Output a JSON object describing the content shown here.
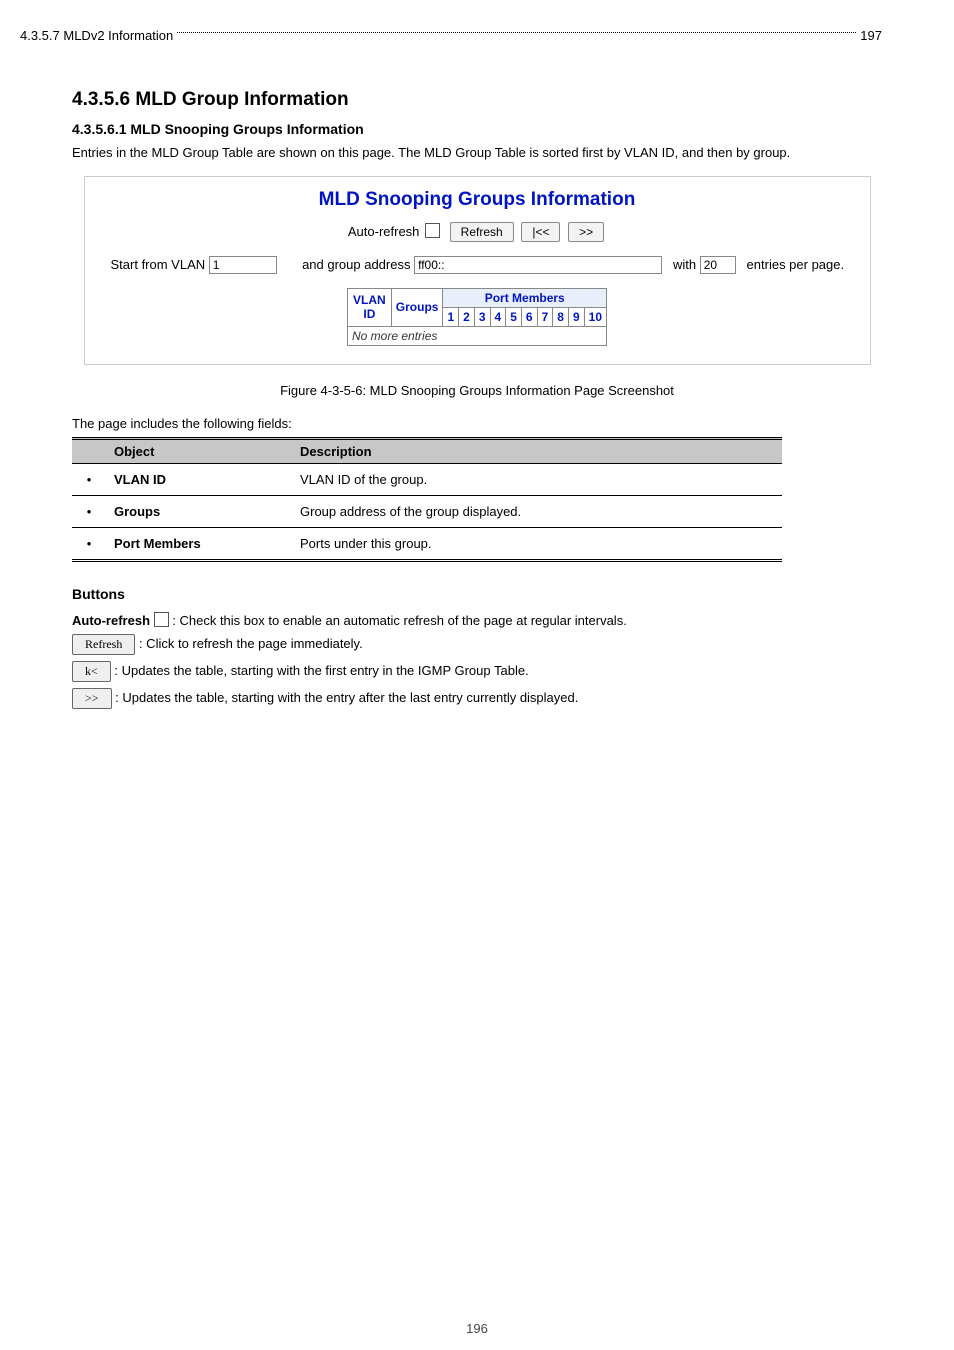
{
  "toc": [
    {
      "title": "4.3.5.7 MLDv2 Information",
      "page": "197"
    }
  ],
  "section": {
    "number_title": "4.3.5.6 MLD Group Information",
    "sub_title": "4.3.5.6.1 MLD Snooping Groups Information",
    "intro": "Entries in the MLD Group Table are shown on this page. The MLD Group Table is sorted first by VLAN ID, and then by group."
  },
  "panel": {
    "title": "MLD Snooping Groups Information",
    "auto_refresh_label": "Auto-refresh",
    "refresh_btn": "Refresh",
    "first_btn": "|<<",
    "next_btn": ">>",
    "filter": {
      "start_label": "Start from VLAN",
      "vlan_value": "1",
      "and_group_label": "and group address",
      "group_value": "ff00::",
      "with_label": "with",
      "entries_value": "20",
      "entries_suffix": "entries per page."
    },
    "table": {
      "port_members_header": "Port Members",
      "vlan_id": "VLAN ID",
      "groups": "Groups",
      "ports": [
        "1",
        "2",
        "3",
        "4",
        "5",
        "6",
        "7",
        "8",
        "9",
        "10"
      ],
      "no_entries": "No more entries"
    }
  },
  "figure_label": "Figure 4-3-5-6: MLD Snooping Groups Information Page Screenshot",
  "obj_desc": "The page includes the following fields:",
  "obj_table": {
    "h1": "Object",
    "h2": "Description",
    "rows": [
      {
        "obj": "VLAN ID",
        "desc": "VLAN ID of the group."
      },
      {
        "obj": "Groups",
        "desc": "Group address of the group displayed."
      },
      {
        "obj": "Port Members",
        "desc": "Ports under this group."
      }
    ]
  },
  "buttons": {
    "header": "Buttons",
    "auto_label": "Auto-refresh",
    "auto_desc": ": Check this box to enable an automatic refresh of the page at regular intervals.",
    "refresh_btn": "Refresh",
    "refresh_desc": ": Click to refresh the page immediately.",
    "first_btn": "k<",
    "first_desc": ": Updates the table, starting with the first entry in the IGMP Group Table.",
    "next_btn": ">>",
    "next_desc": ": Updates the table, starting with the entry after the last entry currently displayed."
  },
  "footer_page": "196"
}
